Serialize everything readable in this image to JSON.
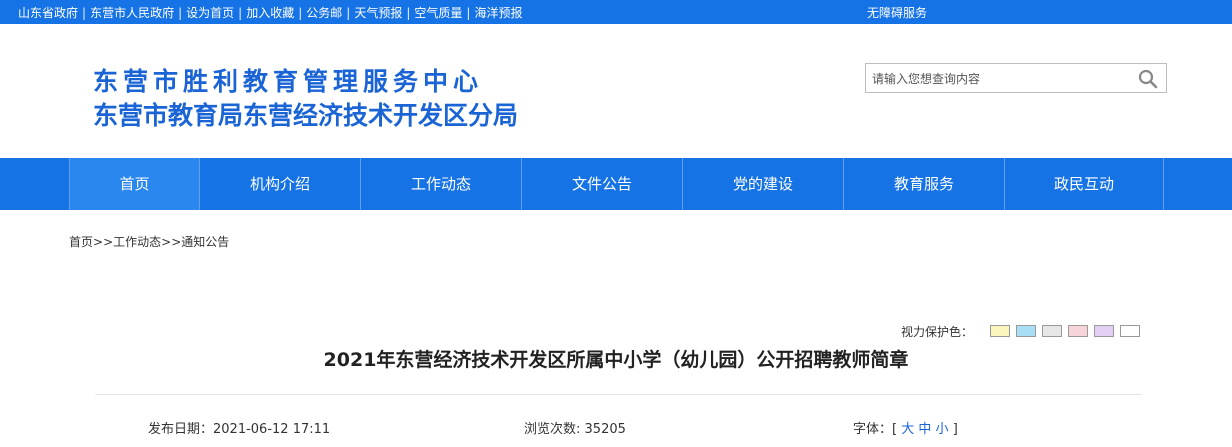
{
  "topbar": {
    "links": [
      "山东省政府",
      "东营市人民政府",
      "设为首页",
      "加入收藏",
      "公务邮",
      "天气预报",
      "空气质量",
      "海洋预报"
    ],
    "separator": "|",
    "accessibility": "无障碍服务"
  },
  "header": {
    "title_line1": "东营市胜利教育管理服务中心",
    "title_line2": "东营市教育局东营经济技术开发区分局",
    "title_color": "#1a64d6"
  },
  "search": {
    "placeholder": "请输入您想查询内容",
    "icon": "search-icon"
  },
  "nav": {
    "items": [
      "首页",
      "机构介绍",
      "工作动态",
      "文件公告",
      "党的建设",
      "教育服务",
      "政民互动"
    ],
    "active_index": 0,
    "color": "#1673e6"
  },
  "breadcrumb": {
    "home": "首页",
    "sep1": ">>",
    "level1": "工作动态",
    "sep2": ">>",
    "level2": "通知公告"
  },
  "vision": {
    "label": "视力保护色：",
    "colors": [
      "#faf5bd",
      "#a8dff4",
      "#e6e6e6",
      "#f7d4da",
      "#e4cff5",
      "#ffffff"
    ]
  },
  "article": {
    "title": "2021年东营经济技术开发区所属中小学（幼儿园）公开招聘教师简章",
    "published_label": "发布日期：",
    "published_value": "2021-06-12 17:11",
    "views_label": "浏览次数:",
    "views_value": "35205",
    "font_label": "字体：",
    "font_open": "[",
    "font_large": "大",
    "font_medium": "中",
    "font_small": "小",
    "font_close": "]"
  }
}
